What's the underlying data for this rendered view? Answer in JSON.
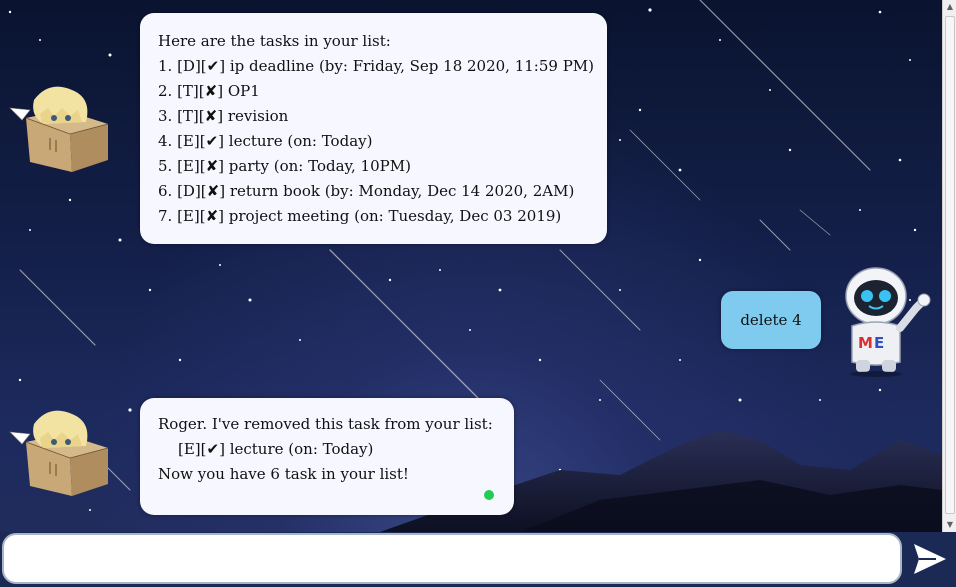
{
  "chat": {
    "messages": [
      {
        "sender": "bot",
        "lines": [
          "Here are the tasks in your list:",
          "1. [D][✔] ip deadline (by: Friday, Sep 18 2020, 11:59 PM)",
          "2. [T][✘] OP1",
          "3. [T][✘] revision",
          "4. [E][✔] lecture (on: Today)",
          "5. [E][✘] party (on: Today, 10PM)",
          "6. [D][✘] return book (by: Monday, Dec 14 2020, 2AM)",
          "7. [E][✘] project meeting (on: Tuesday, Dec 03 2019)"
        ]
      },
      {
        "sender": "user",
        "text": "delete 4"
      },
      {
        "sender": "bot",
        "lines": [
          "Roger. I've removed this task from your list:",
          "[E][✔] lecture (on: Today)",
          "Now you have 6 task in your list!"
        ]
      }
    ]
  },
  "input": {
    "value": "",
    "placeholder": ""
  },
  "icons": {
    "send": "send-arrow-icon",
    "bot_avatar": "bot-avatar-box-character",
    "user_avatar": "user-avatar-robot",
    "status": "online-status-dot"
  },
  "colors": {
    "bot_bubble": "#f7f7ff",
    "user_bubble": "#7ecbef",
    "status_dot": "#22cc55",
    "sky": "#131f48"
  }
}
